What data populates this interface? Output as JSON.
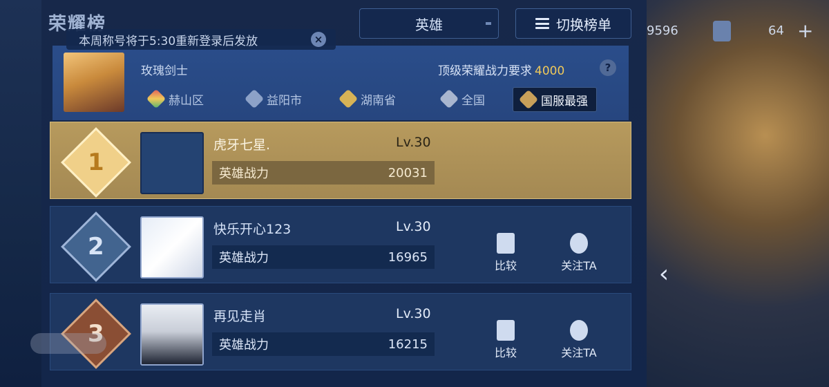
{
  "header": {
    "title": "荣耀榜",
    "notice": "本周称号将于5:30重新登录后发放",
    "hero_select": "英雄",
    "switch_label": "切换榜单"
  },
  "mine": {
    "name": "玫瑰剑士",
    "requirement_label": "顶级荣耀战力要求",
    "requirement_value": "4000"
  },
  "regions": [
    {
      "label": "赫山区"
    },
    {
      "label": "益阳市"
    },
    {
      "label": "湖南省"
    },
    {
      "label": "全国"
    },
    {
      "label": "国服最强"
    }
  ],
  "rows": [
    {
      "rank": "1",
      "name": "虎牙七星.",
      "level": "Lv.30",
      "power_label": "英雄战力",
      "power": "20031"
    },
    {
      "rank": "2",
      "name": "快乐开心123",
      "level": "Lv.30",
      "power_label": "英雄战力",
      "power": "16965"
    },
    {
      "rank": "3",
      "name": "再见走肖",
      "level": "Lv.30",
      "power_label": "英雄战力",
      "power": "16215"
    }
  ],
  "actions": {
    "compare": "比较",
    "follow": "关注TA"
  },
  "right_panel": {
    "currency": "9596",
    "count": "64"
  },
  "colors": {
    "gold_row": "#b79a5d",
    "accent_gold": "#f0c95a",
    "panel_blue": "#1e3761"
  }
}
